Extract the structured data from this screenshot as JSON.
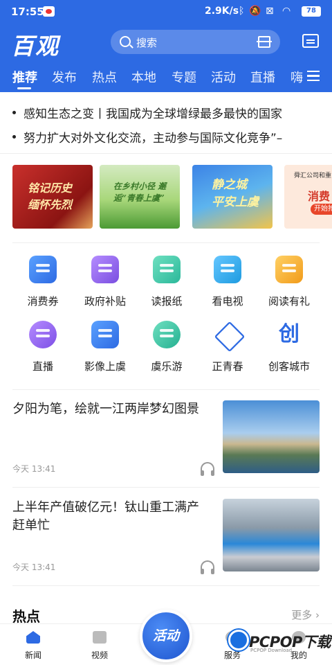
{
  "status_bar": {
    "time": "17:55",
    "net_speed": "2.9K/s",
    "battery": "78",
    "icons": [
      "bluetooth-icon",
      "mute-icon",
      "sim-off-icon",
      "wifi-icon",
      "battery-icon"
    ]
  },
  "header": {
    "logo": "百观",
    "search_placeholder": "搜索",
    "accent_color": "#2d6ae3"
  },
  "tabs": [
    {
      "label": "推荐",
      "active": true
    },
    {
      "label": "发布"
    },
    {
      "label": "热点"
    },
    {
      "label": "本地"
    },
    {
      "label": "专题"
    },
    {
      "label": "活动"
    },
    {
      "label": "直播"
    },
    {
      "label": "嗨"
    }
  ],
  "ticker": [
    "感知生态之变丨我国成为全球增绿最多最快的国家",
    "努力扩大对外文化交流，主动参与国际文化竞争”–"
  ],
  "banners": [
    {
      "title": "铭记历史 缅怀先烈"
    },
    {
      "title": "在乡村小径 邂逅“青春上虞”"
    },
    {
      "title": "静之城 平安上虞"
    },
    {
      "sub": "舜汇公司和重",
      "title": "消费",
      "button": "开始抢"
    }
  ],
  "services": [
    {
      "label": "消费券",
      "icon": "ticket-icon"
    },
    {
      "label": "政府补贴",
      "icon": "subsidy-icon"
    },
    {
      "label": "读报纸",
      "icon": "newspaper-icon"
    },
    {
      "label": "看电视",
      "icon": "tv-icon"
    },
    {
      "label": "阅读有礼",
      "icon": "reading-gift-icon"
    },
    {
      "label": "直播",
      "icon": "live-camera-icon"
    },
    {
      "label": "影像上虞",
      "icon": "camera-icon"
    },
    {
      "label": "虞乐游",
      "icon": "tour-icon"
    },
    {
      "label": "正青春",
      "icon": "star-icon"
    },
    {
      "label": "创客城市",
      "icon": "create-icon",
      "glyph": "创"
    }
  ],
  "news": [
    {
      "title": "夕阳为笔，绘就一江两岸梦幻图景",
      "time": "今天 13:41"
    },
    {
      "title": "上半年产值破亿元！钛山重工满产赶单忙",
      "time": "今天 13:41"
    }
  ],
  "hot": {
    "title": "热点",
    "more": "更多 ›"
  },
  "bottom_nav": {
    "items": [
      {
        "label": "新闻",
        "active": true
      },
      {
        "label": "视频"
      },
      {
        "label": "服务"
      },
      {
        "label": "我的"
      }
    ],
    "center_button": "活动"
  },
  "watermark": {
    "text": "PCPOP下载",
    "sub": "PCPOP Download"
  }
}
